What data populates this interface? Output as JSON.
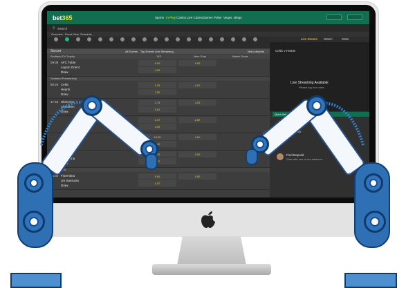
{
  "brand": {
    "logo_main": "bet",
    "logo_accent": "365",
    "accent_color": "#126e51",
    "highlight_color": "#ffdf1b"
  },
  "header": {
    "nav": [
      "Sports",
      "In-Play",
      "Casino",
      "Live Casino",
      "Games",
      "Poker",
      "Vegas",
      "Bingo"
    ],
    "active_nav": "In-Play",
    "buttons": [
      "",
      ""
    ],
    "search_label": "Search",
    "sub_tabs": [
      "Overview",
      "Event View",
      "Schedule"
    ]
  },
  "table": {
    "section_title": "Soccer",
    "filters": [
      "All Events",
      "Top Events",
      "Live Streaming"
    ],
    "col_headers": [
      "1X2",
      "Next Goal",
      "Match Goals"
    ],
    "right_label": "Main Markets",
    "groups": [
      {
        "title": "Scotland Ch Trophy",
        "rows": [
          {
            "time": "09:38",
            "teams": [
              "AFC Fylde",
              "Leyton Orient",
              "Draw"
            ],
            "odds": [
              "9.00",
              "4.50",
              "1.62"
            ]
          }
        ]
      },
      {
        "title": "Scotland Premiership",
        "rows": [
          {
            "time": "80:26",
            "teams": [
              "Celtic",
              "Hearts",
              "Draw"
            ],
            "odds": [
              "1.33",
              "7.50",
              "4.20"
            ]
          },
          {
            "time": "17:43",
            "teams": [
              "Hibernian",
              "Aberdeen",
              "Draw"
            ],
            "odds": [
              "2.75",
              "2.62",
              "3.25"
            ]
          },
          {
            "time": "",
            "teams": [
              "",
              "",
              ""
            ],
            "odds": [
              "2.37",
              "3.40",
              "2.62"
            ]
          },
          {
            "time": "",
            "teams": [
              "",
              "",
              ""
            ],
            "odds": [
              "15.00",
              "1.40",
              "4.00"
            ]
          },
          {
            "time": "",
            "teams": [
              "Sheffield",
              "Barcelona",
              "Draw"
            ],
            "odds": [
              "2.75",
              "2.37",
              "3.00"
            ]
          }
        ]
      },
      {
        "title": "Italia Serie A",
        "rows": [
          {
            "time": "85:30",
            "teams": [
              "Fiorentina",
              "US Sassuolo",
              "Draw"
            ],
            "odds": [
              "5.00",
              "1.57",
              "4.50"
            ]
          }
        ]
      }
    ]
  },
  "right_panel": {
    "match_title": "Celtic v Hearts",
    "stream_title": "Live Streaming Available",
    "stream_sub": "Please log in to view",
    "chat_title": "Quick Bet",
    "chat_subtitle": "Match Commentary",
    "chat_user": "Find Deposit",
    "chat_msg": "Chat with one of our advisors",
    "tabs": [
      "Live Stream",
      "Watch",
      "Stats"
    ]
  }
}
